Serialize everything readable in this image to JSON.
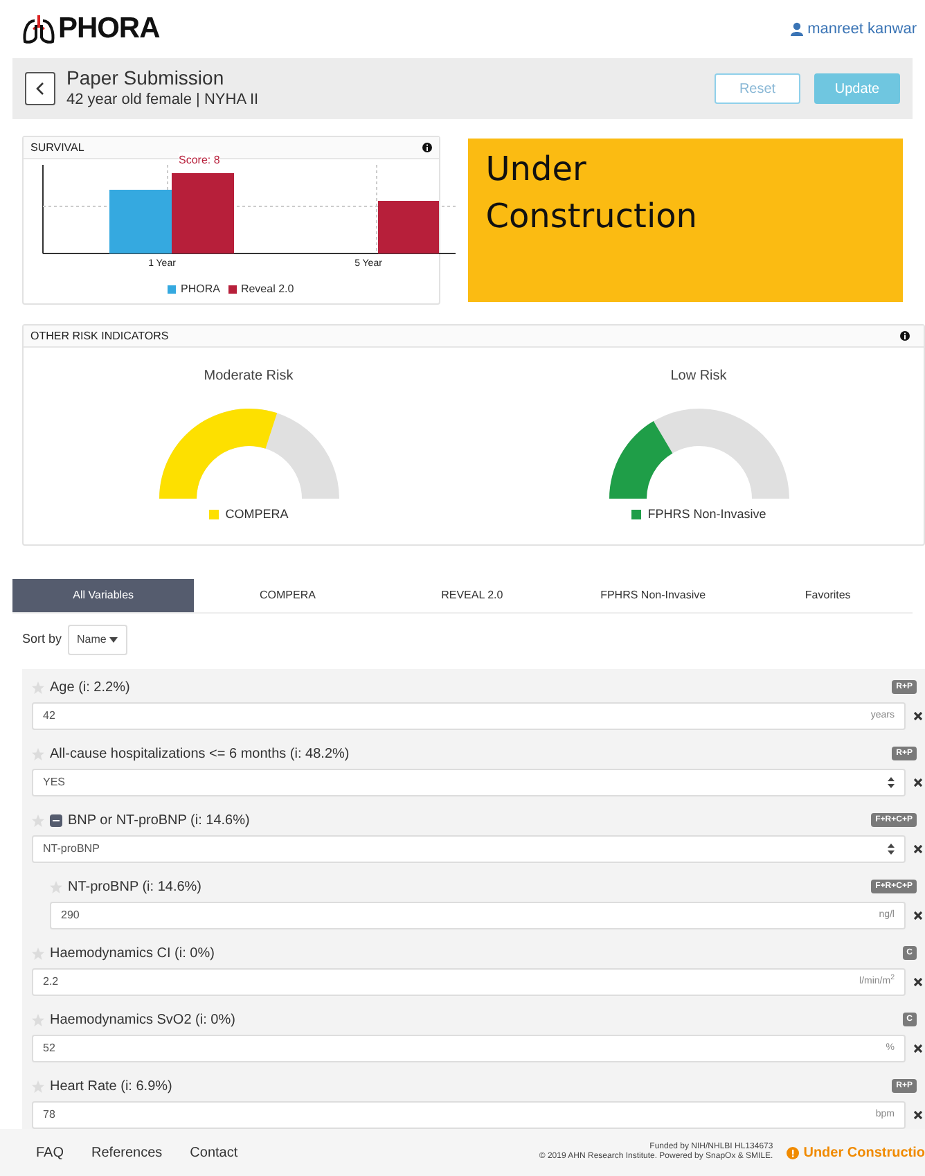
{
  "header": {
    "logo": "PHORA",
    "user": "manreet kanwar"
  },
  "toolbar": {
    "title": "Paper Submission",
    "subtitle": "42 year old female | NYHA II",
    "buttons": [
      {
        "label": "Reset",
        "kind": "outline"
      },
      {
        "label": "Update",
        "kind": "primary"
      }
    ]
  },
  "survival": {
    "title": "SURVIVAL",
    "score_label": "Score: 8",
    "categories": [
      "1 Year",
      "5 Year"
    ],
    "legend": [
      {
        "name": "PHORA",
        "color": "#35a9e0"
      },
      {
        "name": "Reveal 2.0",
        "color": "#b71f3a"
      }
    ]
  },
  "notice": {
    "text": "Under Construction"
  },
  "risk": {
    "title": "OTHER RISK INDICATORS",
    "gauges": [
      {
        "label": "Moderate Risk",
        "name": "COMPERA",
        "color": "#fde000"
      },
      {
        "label": "Low Risk",
        "name": "FPHRS Non-Invasive",
        "color": "#1f9e48"
      }
    ]
  },
  "tabs": [
    {
      "label": "All Variables",
      "selected": true
    },
    {
      "label": "COMPERA",
      "selected": false
    },
    {
      "label": "REVEAL 2.0",
      "selected": false
    },
    {
      "label": "FPHRS Non-Invasive",
      "selected": false
    },
    {
      "label": "Favorites",
      "selected": false
    }
  ],
  "sort": {
    "label": "Sort by",
    "value": "Name"
  },
  "variables": [
    {
      "label": "Age (i: 2.2%)",
      "badge": "R+P",
      "kind": "input",
      "value": "42",
      "unit": "years",
      "favorite": false
    },
    {
      "label": "All-cause hospitalizations <= 6 months (i: 48.2%)",
      "badge": "R+P",
      "kind": "select",
      "value": "YES",
      "favorite": false
    },
    {
      "label": "BNP or NT-proBNP (i: 14.6%)",
      "badge": "F+R+C+P",
      "kind": "select",
      "value": "NT-proBNP",
      "favorite": false,
      "expanded": true,
      "children": [
        {
          "label": "NT-proBNP (i: 14.6%)",
          "badge": "F+R+C+P",
          "kind": "input",
          "value": "290",
          "unit": "ng/l",
          "favorite": false
        }
      ]
    },
    {
      "label": "Haemodynamics CI (i: 0%)",
      "badge": "C",
      "kind": "input",
      "value": "2.2",
      "unit": "l/min/m$^{2}$",
      "favorite": false
    },
    {
      "label": "Haemodynamics SvO2 (i: 0%)",
      "badge": "C",
      "kind": "input",
      "value": "52",
      "unit": "%",
      "favorite": false
    },
    {
      "label": "Heart Rate (i: 6.9%)",
      "badge": "R+P",
      "kind": "input",
      "value": "78",
      "unit": "bpm",
      "favorite": false
    }
  ],
  "footer": {
    "links": [
      "FAQ",
      "References",
      "Contact"
    ],
    "funding": "Funded by NIH/NHLBI HL134673",
    "copyright": "© 2019 AHN Research Institute. Powered by SnapOx & SMILE.",
    "status": "Under Constructio"
  }
}
